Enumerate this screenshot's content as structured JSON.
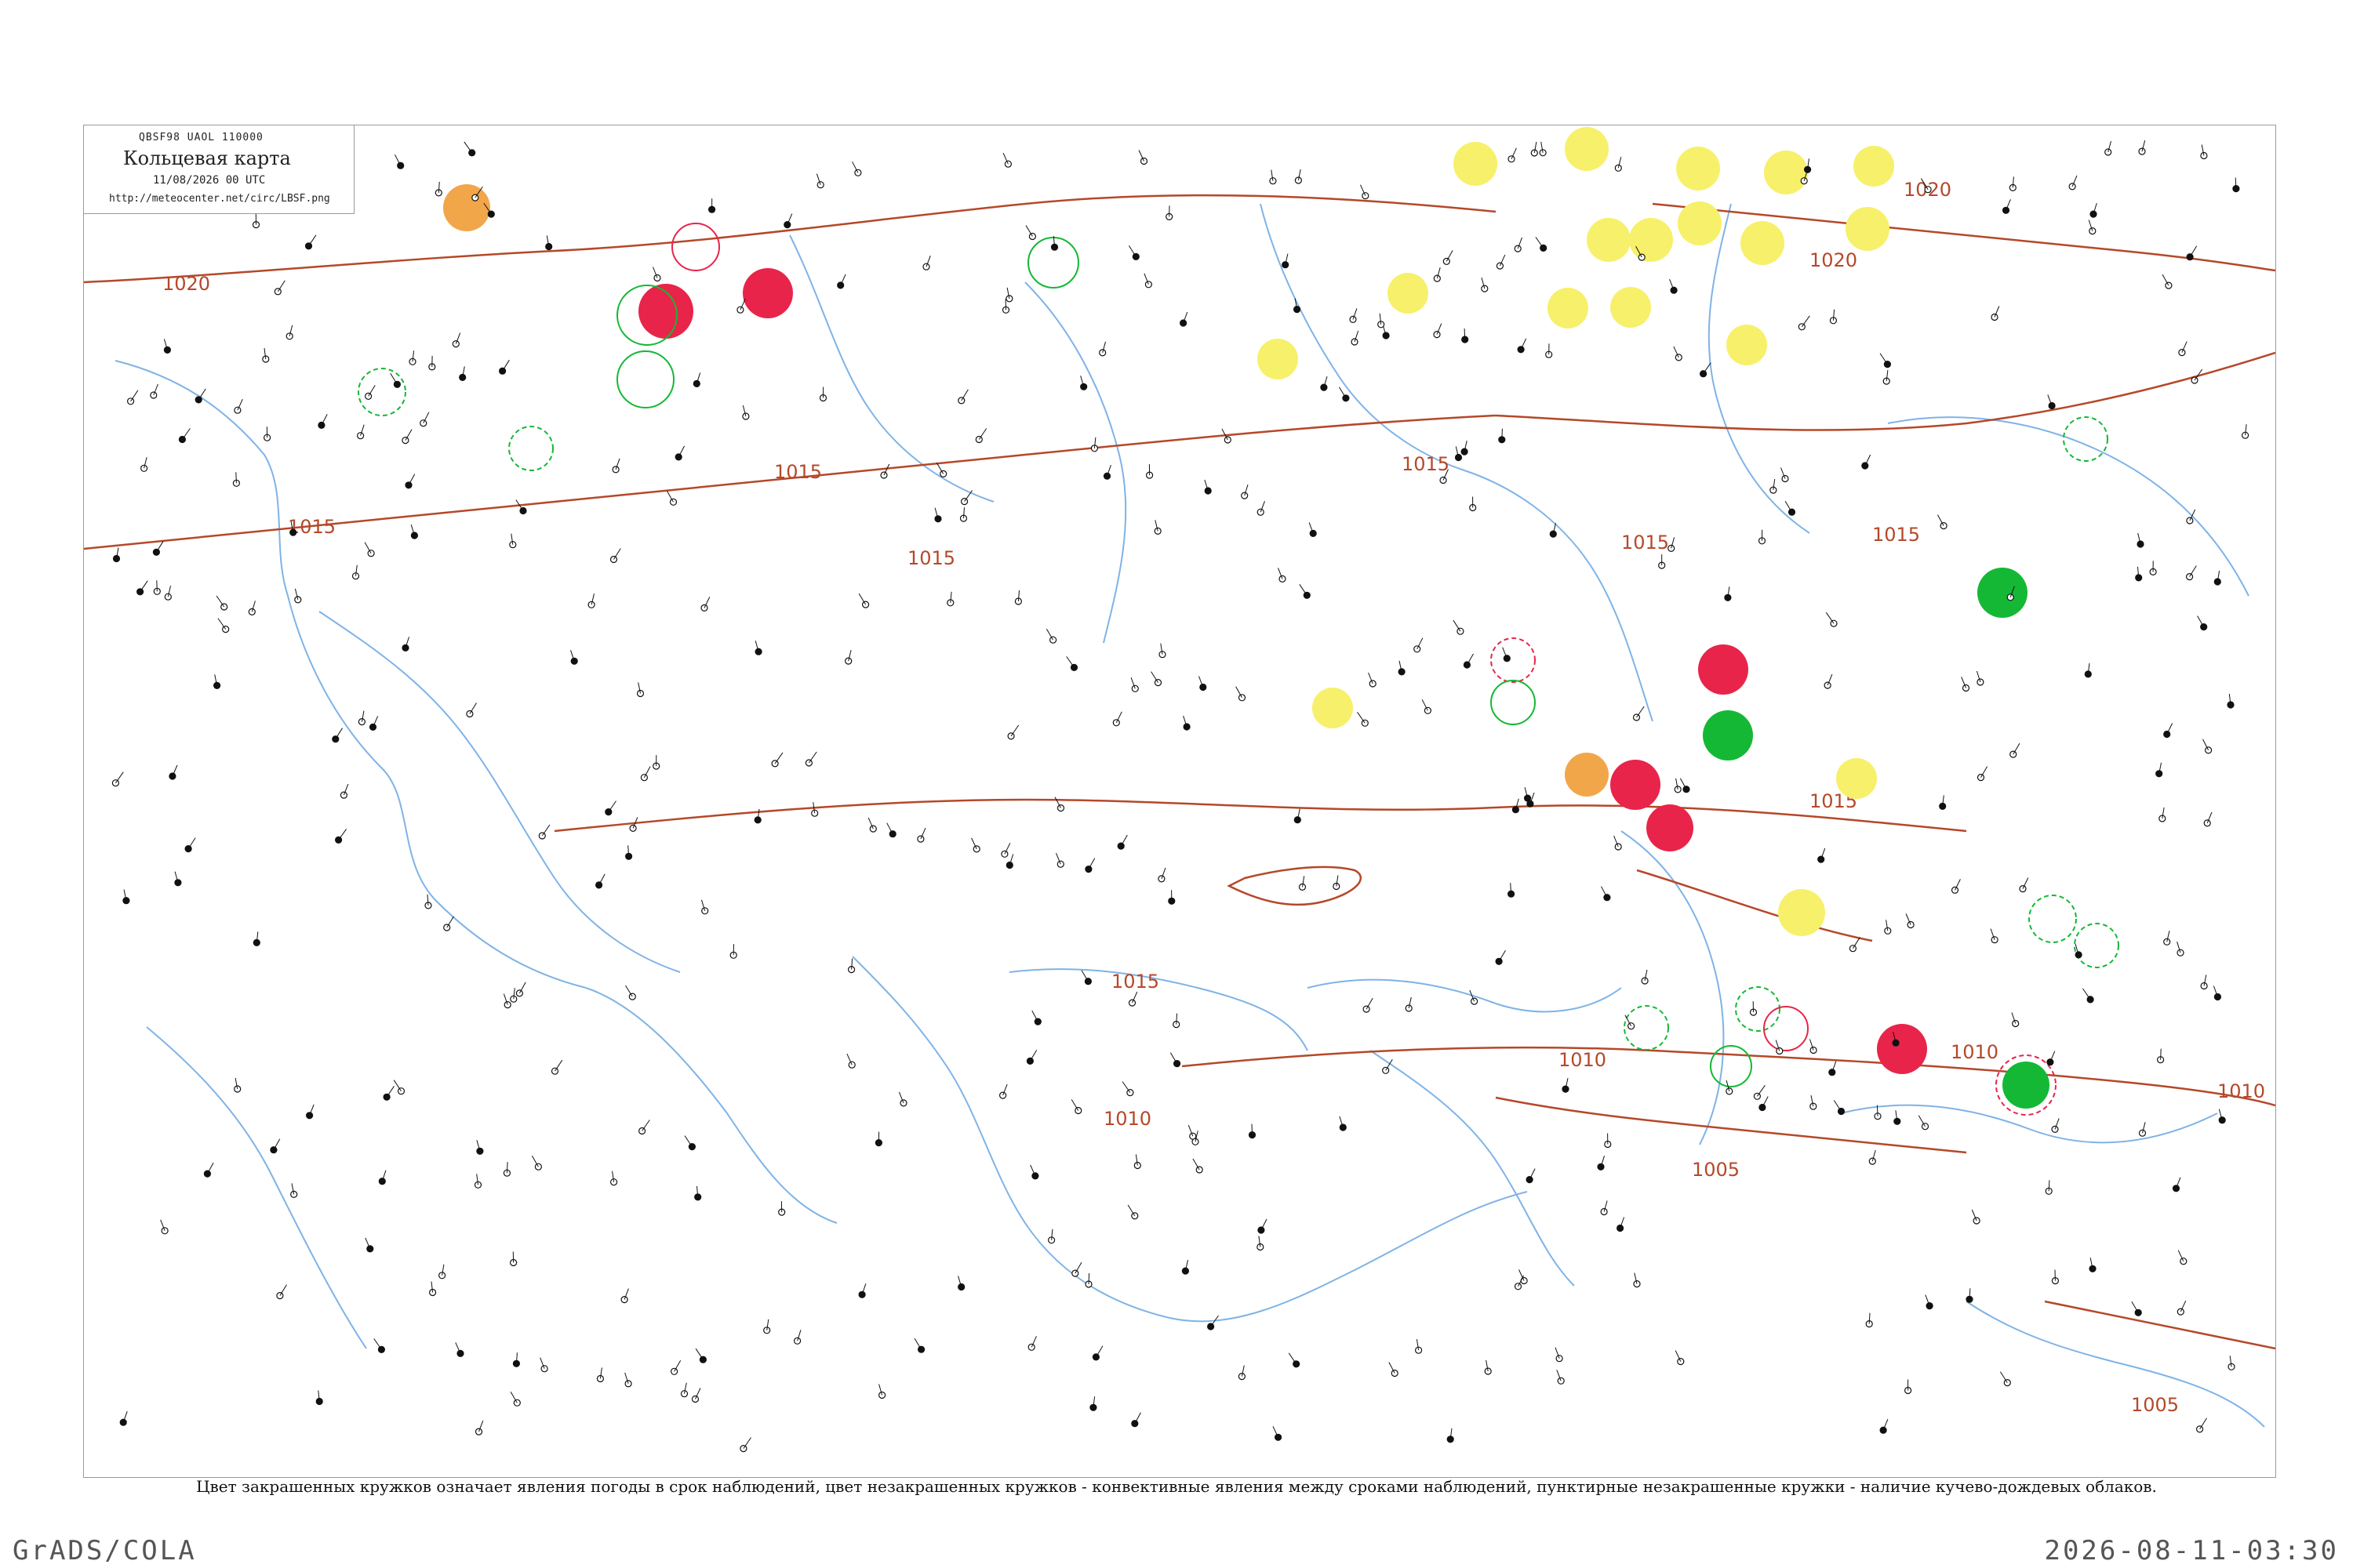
{
  "map": {
    "code_line": "QBSF98  UAOL  110000",
    "title": "Кольцевая карта",
    "datetime": "11/08/2026 00 UTC",
    "url": "http://meteocenter.net/circ/LBSF.png"
  },
  "isobar_labels": [
    "1020",
    "1020",
    "1015",
    "1015",
    "1015",
    "1015",
    "1015",
    "1015",
    "1010",
    "1010",
    "1010",
    "1010",
    "1005",
    "1005",
    "1020",
    "1015",
    "1015"
  ],
  "colors": {
    "coast": "#7fb3e6",
    "isobar": "#b5482a",
    "red": "#e8244a",
    "green": "#14b834",
    "yellow": "#f7f06a",
    "orange": "#f2a64a"
  },
  "caption": "Цвет закрашенных кружков означает явления погоды в срок наблюдений, цвет незакрашенных кружков - конвективные явления между сроками наблюдений, пунктирные незакрашенные кружки - наличие кучево-дождевых облаков.",
  "footer": {
    "left": "GrADS/COLA",
    "right": "2026-08-11-03:30"
  }
}
